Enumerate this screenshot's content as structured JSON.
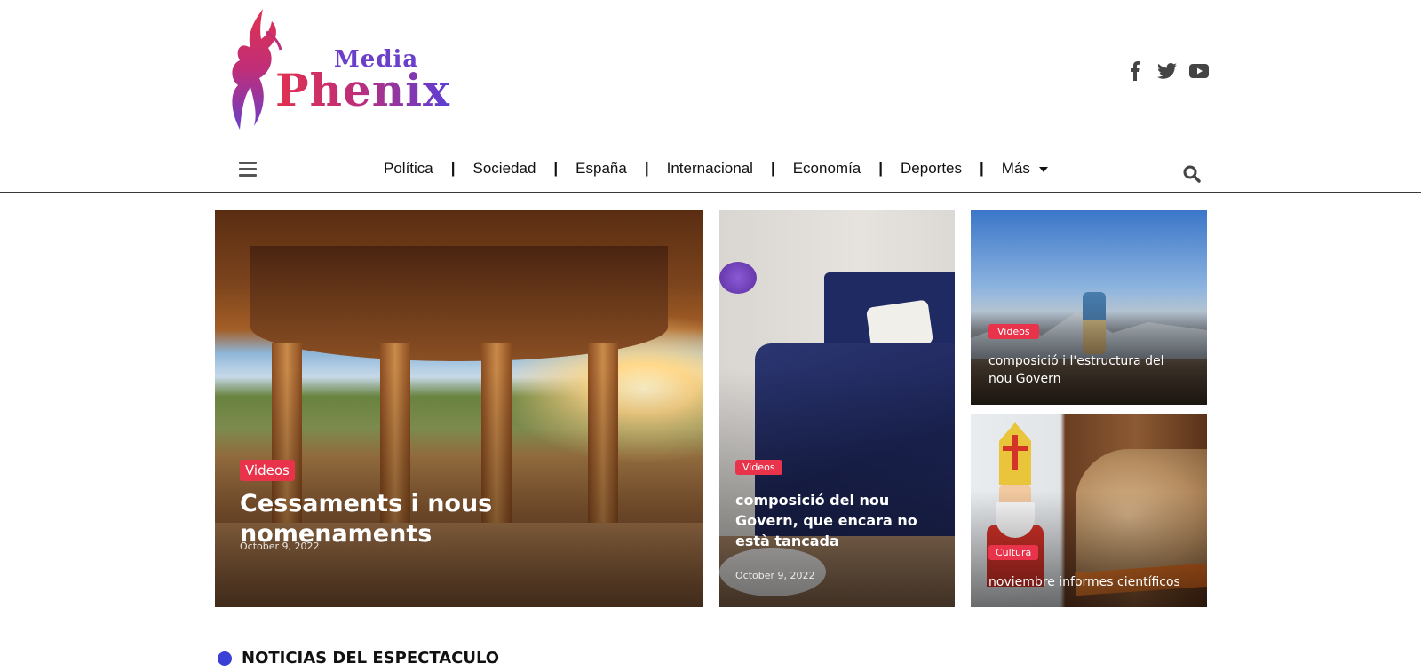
{
  "header": {
    "logo": {
      "media": "Media",
      "name": "Phenix",
      "alt": "Media Phenix"
    },
    "social": [
      {
        "name": "facebook-icon"
      },
      {
        "name": "twitter-icon"
      },
      {
        "name": "youtube-icon"
      }
    ]
  },
  "nav": {
    "items": [
      {
        "label": "Política"
      },
      {
        "label": "Sociedad"
      },
      {
        "label": "España"
      },
      {
        "label": "Internacional"
      },
      {
        "label": "Economía"
      },
      {
        "label": "Deportes"
      },
      {
        "label": "Más"
      }
    ],
    "separator": "|"
  },
  "featured": [
    {
      "category": "Videos",
      "title": "Cessaments i nous nomenaments",
      "date": "October 9, 2022"
    },
    {
      "category": "Videos",
      "title": "composició del nou Govern, que encara no està tancada",
      "date": "October 9, 2022"
    },
    {
      "category": "Videos",
      "title": "composició i l'estructura del nou Govern"
    },
    {
      "category": "Cultura",
      "title": "noviembre informes científicos"
    }
  ],
  "section": {
    "title": "NOTICIAS DEL ESPECTACULO",
    "accent": "#3a3fd6"
  },
  "colors": {
    "badge": "#e8334a",
    "nav_border": "#3a3a3a"
  }
}
